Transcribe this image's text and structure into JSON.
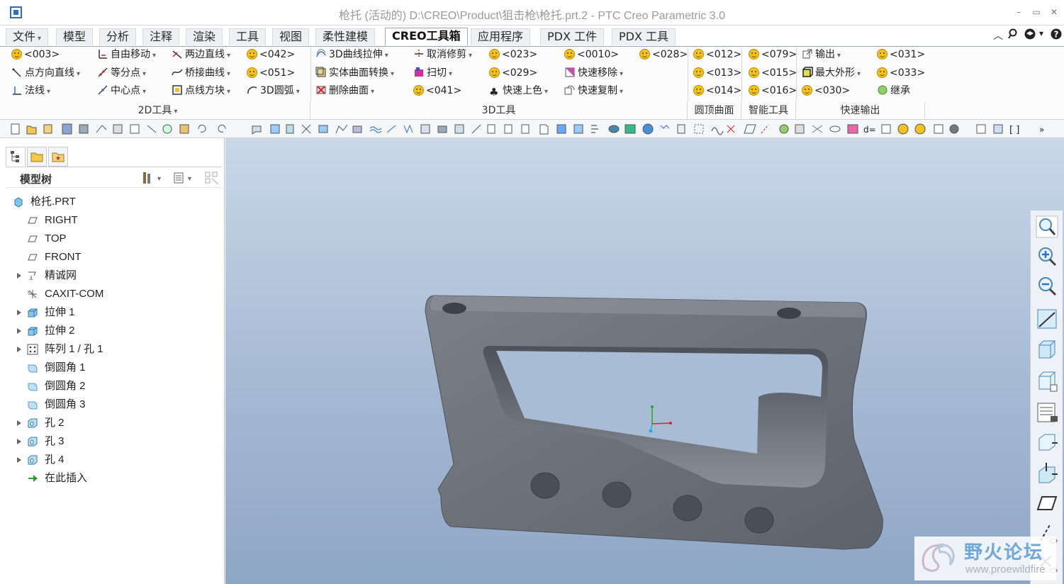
{
  "window": {
    "title": "枪托 (活动的) D:\\CREO\\Product\\狙击枪\\枪托.prt.2 - PTC Creo Parametric 3.0",
    "controls": [
      "–",
      "▭",
      "✕"
    ]
  },
  "tabs": [
    {
      "label": "文件",
      "dropdown": true
    },
    {
      "label": "模型"
    },
    {
      "label": "分析"
    },
    {
      "label": "注释"
    },
    {
      "label": "渲染"
    },
    {
      "label": "工具"
    },
    {
      "label": "视图"
    },
    {
      "label": "柔性建模"
    },
    {
      "label": "CREO工具箱",
      "active": true
    },
    {
      "label": "应用程序"
    },
    {
      "label": "PDX 工件"
    },
    {
      "label": "PDX 工具"
    }
  ],
  "ribbon": {
    "col1": [
      "<003>",
      "点方向直线",
      "法线"
    ],
    "col2": [
      "自由移动",
      "等分点",
      "中心点"
    ],
    "col3": [
      "两边直线",
      "桥接曲线",
      "点线方块"
    ],
    "col4": [
      "<042>",
      "<051>",
      "3D圆弧"
    ],
    "col5": [
      "3D曲线拉伸",
      "实体曲面转换",
      "删除曲面"
    ],
    "col6": [
      "取消修剪",
      "扫切",
      "<041>"
    ],
    "col7": [
      "<023>",
      "<029>",
      "快速上色"
    ],
    "col8": [
      "<0010>",
      "快速移除",
      "快速复制"
    ],
    "col9": [
      "<028>"
    ],
    "col10": [
      "<012>",
      "<013>",
      "<014>"
    ],
    "col11": [
      "<079>",
      "<015>",
      "<016>"
    ],
    "col12": [
      "输出",
      "最大外形",
      "<030>"
    ],
    "col13": [
      "<031>",
      "<033>",
      "继承"
    ],
    "groups": [
      "2D工具",
      "3D工具",
      "圆顶曲面",
      "智能工具",
      "快速输出"
    ]
  },
  "model_tree": {
    "title": "模型树",
    "items": [
      {
        "label": "枪托.PRT",
        "icon": "part-icon"
      },
      {
        "label": "RIGHT",
        "icon": "datum-plane-icon"
      },
      {
        "label": "TOP",
        "icon": "datum-plane-icon"
      },
      {
        "label": "FRONT",
        "icon": "datum-plane-icon"
      },
      {
        "label": "精诚网",
        "icon": "sketch-icon",
        "expandable": true
      },
      {
        "label": "CAXIT-COM",
        "icon": "csys-icon"
      },
      {
        "label": "拉伸 1",
        "icon": "extrude-icon",
        "expandable": true
      },
      {
        "label": "拉伸 2",
        "icon": "extrude-icon",
        "expandable": true
      },
      {
        "label": "阵列 1 / 孔 1",
        "icon": "pattern-icon",
        "expandable": true
      },
      {
        "label": "倒圆角 1",
        "icon": "round-icon"
      },
      {
        "label": "倒圆角 2",
        "icon": "round-icon"
      },
      {
        "label": "倒圆角 3",
        "icon": "round-icon"
      },
      {
        "label": "孔 2",
        "icon": "hole-icon",
        "expandable": true
      },
      {
        "label": "孔 3",
        "icon": "hole-icon",
        "expandable": true
      },
      {
        "label": "孔 4",
        "icon": "hole-icon",
        "expandable": true
      },
      {
        "label": "在此插入",
        "icon": "insert-here-icon"
      }
    ]
  },
  "watermark": {
    "title": "野火论坛",
    "url": "www.proewildfire"
  },
  "colors": {
    "accent": "#2c6fc4",
    "model_gray": "#6b7079",
    "viewport_top": "#c9d7e8",
    "viewport_bottom": "#8ea6c6"
  }
}
